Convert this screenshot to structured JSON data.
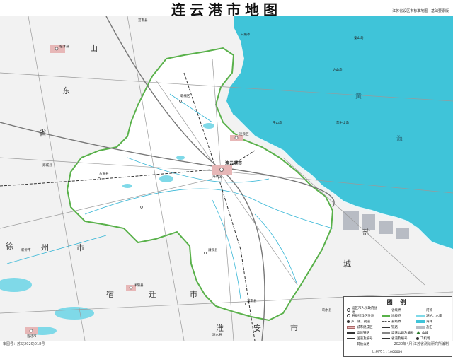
{
  "map": {
    "title": "连云港市地图",
    "subtitle": "江苏省设区市标准地图 · 基础要素版",
    "footer_left": "审图号：苏S(2020)018号",
    "footer_right": "2020年4月 江苏省测绘研究所编制",
    "colors": {
      "sea": "#3fc4d9",
      "lake": "#7fd9e8",
      "boundary": "#59b14a",
      "land_inside": "#ffffff",
      "land_outside": "#f2f2f2",
      "salt_field": "#b8bcc4",
      "urban": "#e7b7b7"
    }
  },
  "labels": {
    "region_shandong": [
      "山",
      "东",
      "省"
    ],
    "xuzhou_shi": [
      "徐",
      "州",
      "市"
    ],
    "suqian_shi": [
      "宿",
      "迁",
      "市"
    ],
    "huaian_shi": [
      "淮",
      "安",
      "市"
    ],
    "yancheng_shi": [
      "盐",
      "城"
    ],
    "sea_yellow": [
      "黄",
      "海"
    ],
    "city_center": "连云港市",
    "towns_main": [
      "连云港市",
      "海州区",
      "连云区",
      "赣榆区",
      "东海县",
      "灌云县",
      "灌南县"
    ],
    "neighbor_towns": [
      "临沭县",
      "郯城县",
      "新沂市",
      "沭阳县",
      "宿迁市",
      "涟水县",
      "响水县",
      "莒南县",
      "日照市"
    ],
    "islands": [
      "秦山岛",
      "达山岛",
      "车牛山岛",
      "平山岛"
    ]
  },
  "legend": {
    "title": "图 例",
    "items": [
      {
        "label": "设区市人民政府驻地",
        "icon": "capital-dot"
      },
      {
        "label": "县级行政区驻地",
        "icon": "county-dot"
      },
      {
        "label": "乡、镇、街道",
        "icon": "town-dot"
      },
      {
        "label": "城市建成区",
        "icon": "urban-fill"
      },
      {
        "label": "省级界",
        "icon": "province-line"
      },
      {
        "label": "地级界",
        "icon": "city-line"
      },
      {
        "label": "县级界",
        "icon": "county-line"
      },
      {
        "label": "铁路",
        "icon": "railway-line"
      },
      {
        "label": "高速铁路",
        "icon": "hsr-line"
      },
      {
        "label": "高速公路及编号",
        "icon": "expressway-line"
      },
      {
        "label": "国道及编号",
        "icon": "national-road"
      },
      {
        "label": "省道及编号",
        "icon": "provincial-road"
      },
      {
        "label": "其他公路",
        "icon": "other-road"
      },
      {
        "label": "河流",
        "icon": "river-line"
      },
      {
        "label": "湖泊、水库",
        "icon": "lake-fill"
      },
      {
        "label": "海洋",
        "icon": "sea-fill"
      },
      {
        "label": "盐田",
        "icon": "salt-fill"
      },
      {
        "label": "山峰",
        "icon": "peak-icon"
      },
      {
        "label": "飞机场",
        "icon": "airport-icon"
      }
    ],
    "scale": "比例尺 1 : 1000000"
  }
}
